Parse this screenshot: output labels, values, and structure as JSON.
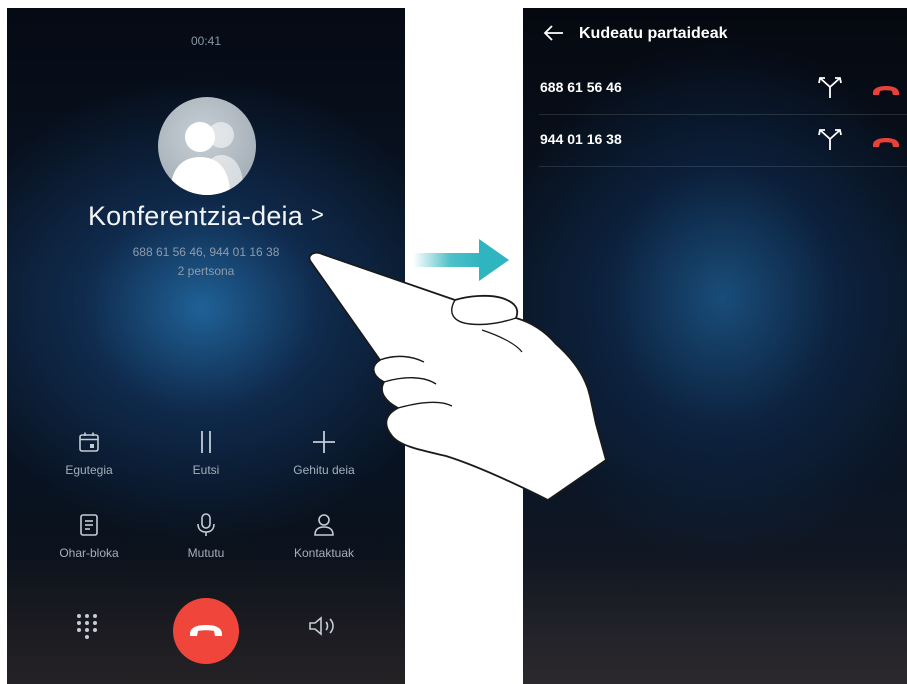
{
  "left_screen": {
    "time": "00:41",
    "contact": {
      "title": "Konferentzia-deia",
      "chevron": ">",
      "numbers": "688 61 56 46, 944 01 16 38",
      "count": "2 pertsona",
      "avatar_icon": "group-avatar-icon"
    },
    "controls": [
      {
        "label": "Egutegia",
        "icon": "calendar-icon"
      },
      {
        "label": "Eutsi",
        "icon": "pause-icon"
      },
      {
        "label": "Gehitu deia",
        "icon": "plus-icon"
      },
      {
        "label": "Ohar-bloka",
        "icon": "notepad-icon"
      },
      {
        "label": "Mututu",
        "icon": "microphone-icon"
      },
      {
        "label": "Kontaktuak",
        "icon": "contact-icon"
      }
    ],
    "bottom_bar": {
      "dialpad_icon": "dialpad-icon",
      "end_call_icon": "end-call-icon",
      "end_call_color": "#f0453a",
      "speaker_icon": "speaker-icon"
    }
  },
  "transition": {
    "arrow_icon": "arrow-right-icon",
    "arrow_color": "#2fb5bf"
  },
  "right_screen": {
    "title": "Kudeatu partaideak",
    "back_icon": "back-arrow-icon",
    "participants": [
      {
        "number": "688 61 56 46",
        "split_icon": "split-call-icon",
        "hangup_icon": "hangup-icon"
      },
      {
        "number": "944 01 16 38",
        "split_icon": "split-call-icon",
        "hangup_icon": "hangup-icon"
      }
    ],
    "hangup_color": "#e8413a"
  },
  "overlay": {
    "gesture_icon": "tapping-hand-icon"
  }
}
